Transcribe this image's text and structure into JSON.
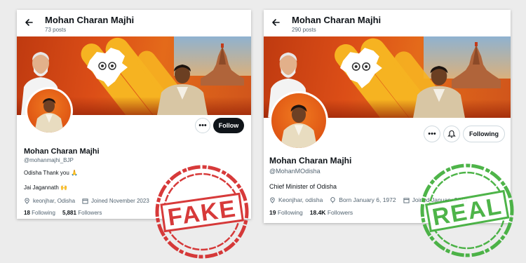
{
  "fake": {
    "header": {
      "name": "Mohan Charan Majhi",
      "posts": "73 posts"
    },
    "button": "Follow",
    "profile": {
      "name": "Mohan Charan Majhi",
      "handle": "@mohanmajhi_BJP",
      "bio_line1": "Odisha Thank you 🙏",
      "bio_line2": "Jai Jagannath 🙌",
      "location": "keonjhar, Odisha",
      "joined": "Joined November 2023",
      "following_count": "18",
      "following_label": "Following",
      "followers_count": "5,881",
      "followers_label": "Followers"
    },
    "stamp": "FAKE"
  },
  "real": {
    "header": {
      "name": "Mohan Charan Majhi",
      "posts": "290 posts"
    },
    "button": "Following",
    "profile": {
      "name": "Mohan Charan Majhi",
      "handle": "@MohanMOdisha",
      "bio": "Chief Minister of Odisha",
      "location": "Keonjhar, odisha",
      "born": "Born January 6, 1972",
      "joined": "Joined January 2019",
      "following_count": "19",
      "following_label": "Following",
      "followers_count": "18.4K",
      "followers_label": "Followers"
    },
    "stamp": "REAL"
  },
  "colors": {
    "fake_stamp": "#d42a2a",
    "real_stamp": "#3fae3a",
    "banner": "#d8470f",
    "stripe": "#f6b321"
  },
  "icons": [
    "back-arrow-icon",
    "more-icon",
    "notification-bell-icon",
    "location-icon",
    "calendar-icon",
    "balloon-icon"
  ]
}
